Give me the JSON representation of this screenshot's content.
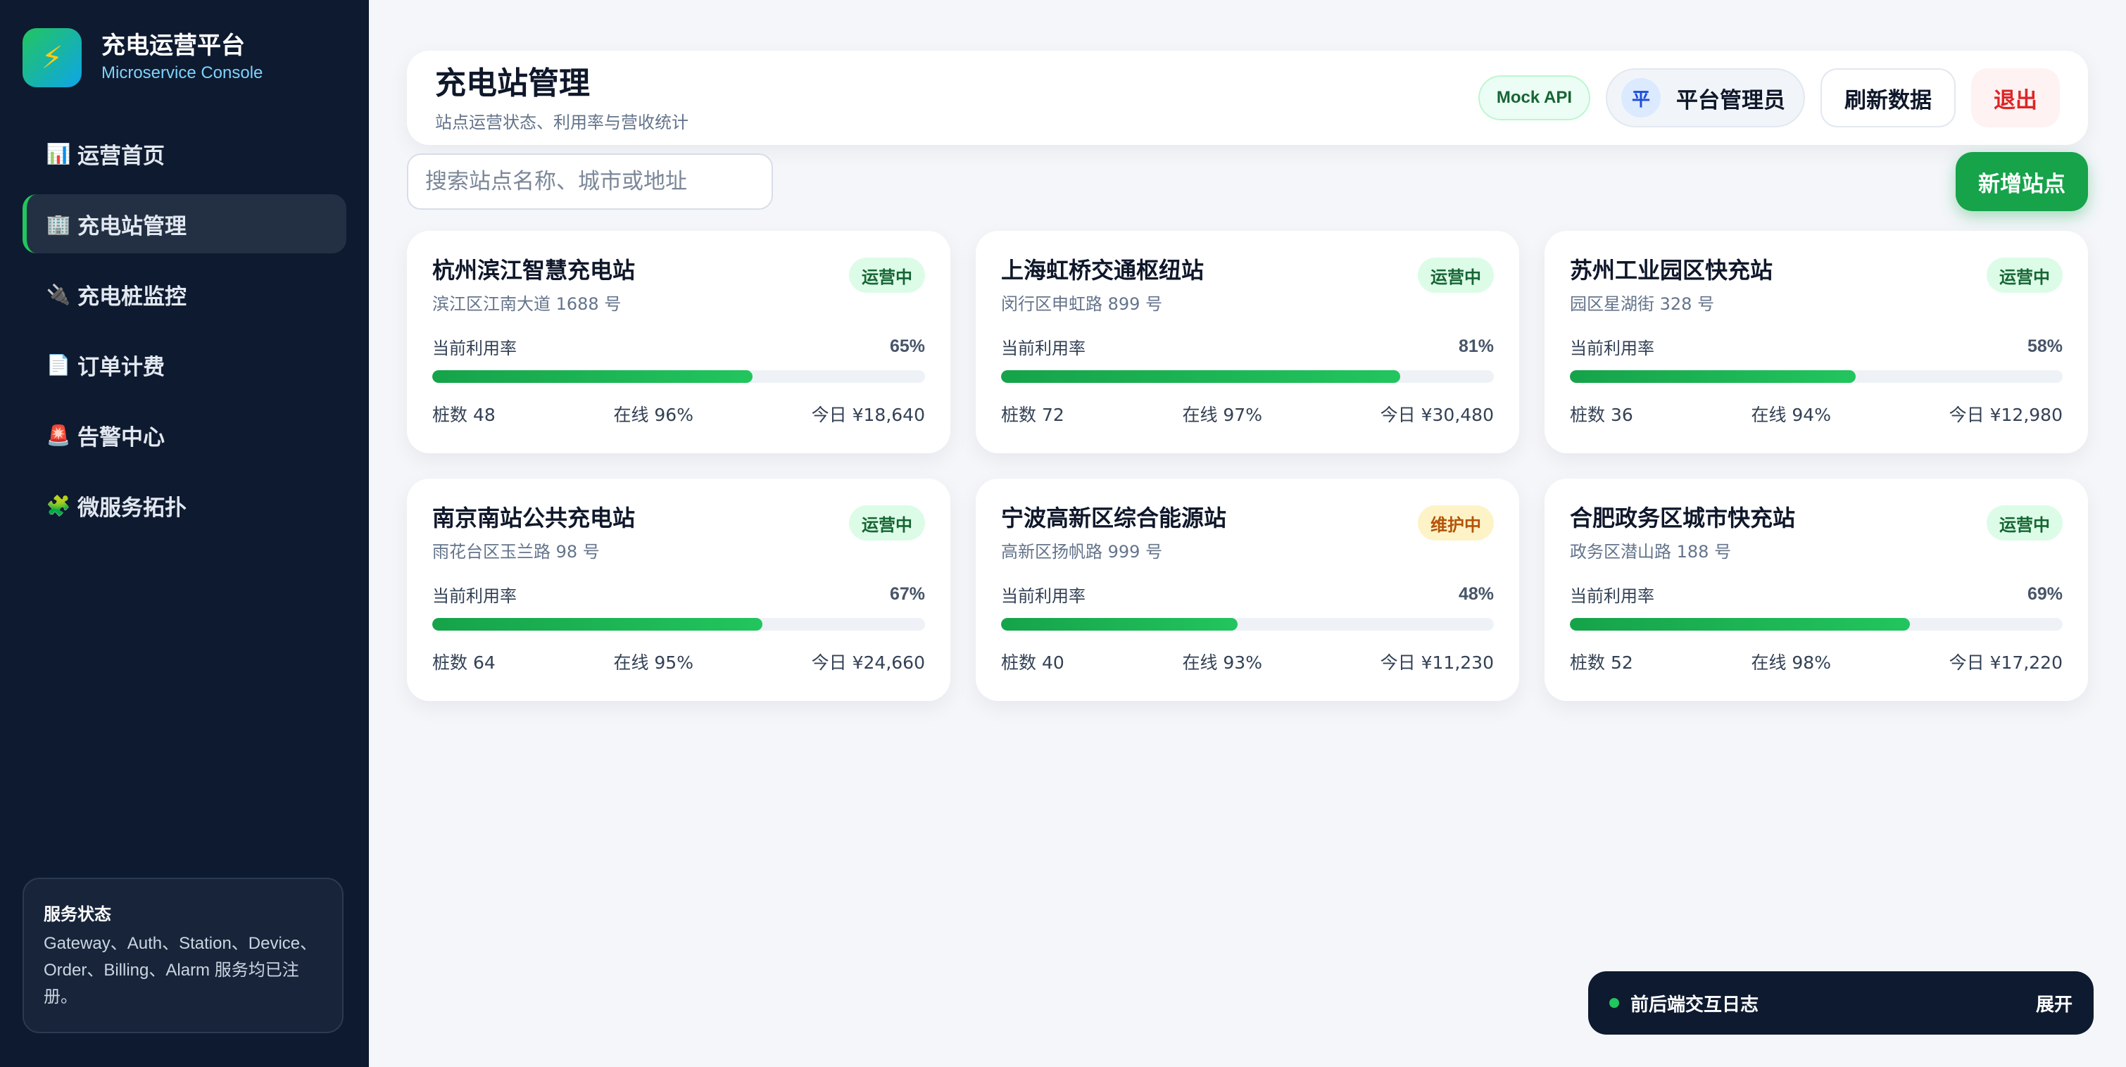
{
  "brand": {
    "icon": "lightning-icon",
    "title": "充电运营平台",
    "subtitle": "Microservice Console"
  },
  "sidebar": {
    "items": [
      {
        "icon": "📊",
        "icon_name": "bar-chart-icon",
        "label": "运营首页",
        "active": false
      },
      {
        "icon": "🏢",
        "icon_name": "building-icon",
        "label": "充电站管理",
        "active": true
      },
      {
        "icon": "🔌",
        "icon_name": "plug-icon",
        "label": "充电桩监控",
        "active": false
      },
      {
        "icon": "📄",
        "icon_name": "document-icon",
        "label": "订单计费",
        "active": false
      },
      {
        "icon": "🚨",
        "icon_name": "siren-icon",
        "label": "告警中心",
        "active": false
      },
      {
        "icon": "🧩",
        "icon_name": "puzzle-icon",
        "label": "微服务拓扑",
        "active": false
      }
    ],
    "service_status": {
      "title": "服务状态",
      "text": "Gateway、Auth、Station、Device、Order、Billing、Alarm 服务均已注册。"
    }
  },
  "header": {
    "title": "充电站管理",
    "subtitle": "站点运营状态、利用率与营收统计",
    "mock_badge": "Mock API",
    "user": {
      "avatar": "平",
      "name": "平台管理员"
    },
    "refresh_label": "刷新数据",
    "logout_label": "退出"
  },
  "toolbar": {
    "search_placeholder": "搜索站点名称、城市或地址",
    "search_value": "",
    "add_label": "新增站点"
  },
  "stations_labels": {
    "utilization": "当前利用率"
  },
  "stations": [
    {
      "name": "杭州滨江智慧充电站",
      "address": "滨江区江南大道 1688 号",
      "status": "运营中",
      "status_type": "ok",
      "utilization": 65,
      "utilization_text": "65%",
      "piles": "桩数 48",
      "online": "在线 96%",
      "revenue": "今日 ¥18,640"
    },
    {
      "name": "上海虹桥交通枢纽站",
      "address": "闵行区申虹路 899 号",
      "status": "运营中",
      "status_type": "ok",
      "utilization": 81,
      "utilization_text": "81%",
      "piles": "桩数 72",
      "online": "在线 97%",
      "revenue": "今日 ¥30,480"
    },
    {
      "name": "苏州工业园区快充站",
      "address": "园区星湖街 328 号",
      "status": "运营中",
      "status_type": "ok",
      "utilization": 58,
      "utilization_text": "58%",
      "piles": "桩数 36",
      "online": "在线 94%",
      "revenue": "今日 ¥12,980"
    },
    {
      "name": "南京南站公共充电站",
      "address": "雨花台区玉兰路 98 号",
      "status": "运营中",
      "status_type": "ok",
      "utilization": 67,
      "utilization_text": "67%",
      "piles": "桩数 64",
      "online": "在线 95%",
      "revenue": "今日 ¥24,660"
    },
    {
      "name": "宁波高新区综合能源站",
      "address": "高新区扬帆路 999 号",
      "status": "维护中",
      "status_type": "warn",
      "utilization": 48,
      "utilization_text": "48%",
      "piles": "桩数 40",
      "online": "在线 93%",
      "revenue": "今日 ¥11,230"
    },
    {
      "name": "合肥政务区城市快充站",
      "address": "政务区潜山路 188 号",
      "status": "运营中",
      "status_type": "ok",
      "utilization": 69,
      "utilization_text": "69%",
      "piles": "桩数 52",
      "online": "在线 98%",
      "revenue": "今日 ¥17,220"
    }
  ],
  "log_panel": {
    "title": "前后端交互日志",
    "toggle_label": "展开"
  },
  "colors": {
    "sidebar_bg": "#0e1a2f",
    "accent_green": "#16a34a",
    "status_ok_bg": "#dcfce7",
    "status_warn_bg": "#fef3c7",
    "danger": "#dc2626"
  }
}
